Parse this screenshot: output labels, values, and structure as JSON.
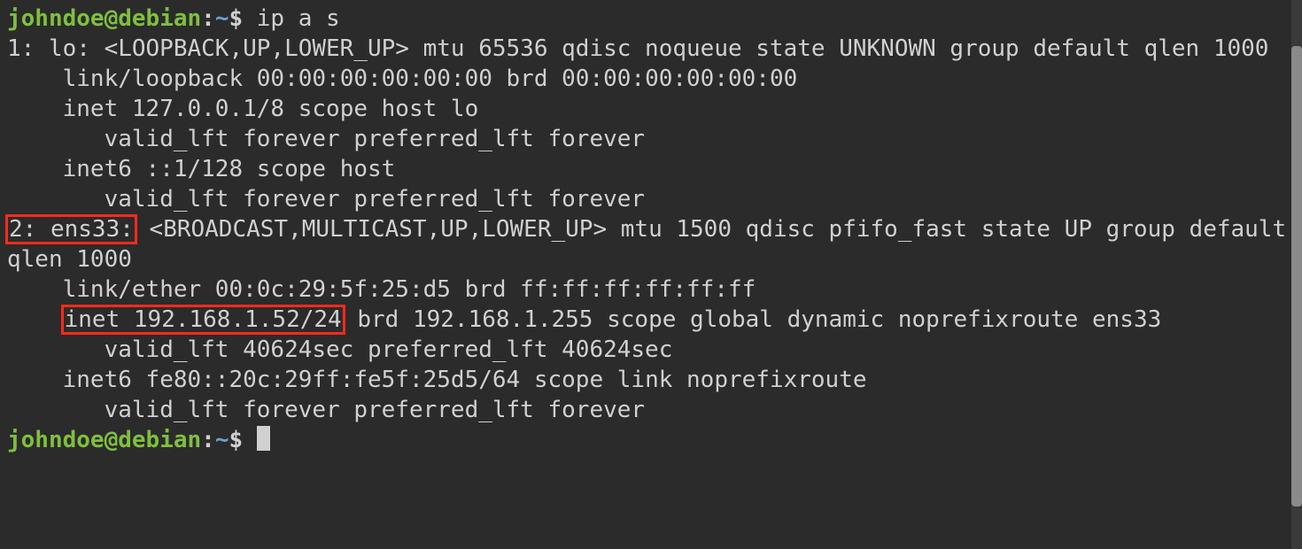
{
  "prompt1": {
    "user": "johndoe",
    "at": "@",
    "host": "debian",
    "colon": ":",
    "path": "~",
    "dollar": "$ ",
    "command": "ip a s"
  },
  "output": {
    "line1": "1: lo: <LOOPBACK,UP,LOWER_UP> mtu 65536 qdisc noqueue state UNKNOWN group default qlen 1000",
    "line2": "    link/loopback 00:00:00:00:00:00 brd 00:00:00:00:00:00",
    "line3": "    inet 127.0.0.1/8 scope host lo",
    "line4": "       valid_lft forever preferred_lft forever",
    "line5": "    inet6 ::1/128 scope host ",
    "line6": "       valid_lft forever preferred_lft forever",
    "iface2_label": "2: ens33:",
    "iface2_rest": " <BROADCAST,MULTICAST,UP,LOWER_UP> mtu 1500 qdisc pfifo_fast state UP group default qlen 1000",
    "line8": "    link/ether 00:0c:29:5f:25:d5 brd ff:ff:ff:ff:ff:ff",
    "line9_pre": "    ",
    "line9_hl": "inet 192.168.1.52/24",
    "line9_post": " brd 192.168.1.255 scope global dynamic noprefixroute ens33",
    "line10": "       valid_lft 40624sec preferred_lft 40624sec",
    "line11": "    inet6 fe80::20c:29ff:fe5f:25d5/64 scope link noprefixroute ",
    "line12": "       valid_lft forever preferred_lft forever"
  },
  "prompt2": {
    "user": "johndoe",
    "at": "@",
    "host": "debian",
    "colon": ":",
    "path": "~",
    "dollar": "$ "
  },
  "colors": {
    "bg": "#2b2b2b",
    "fg": "#d0d0d0",
    "user_host": "#7fbf3f",
    "path": "#6a9fd4",
    "highlight_border": "#ff2a1a"
  }
}
